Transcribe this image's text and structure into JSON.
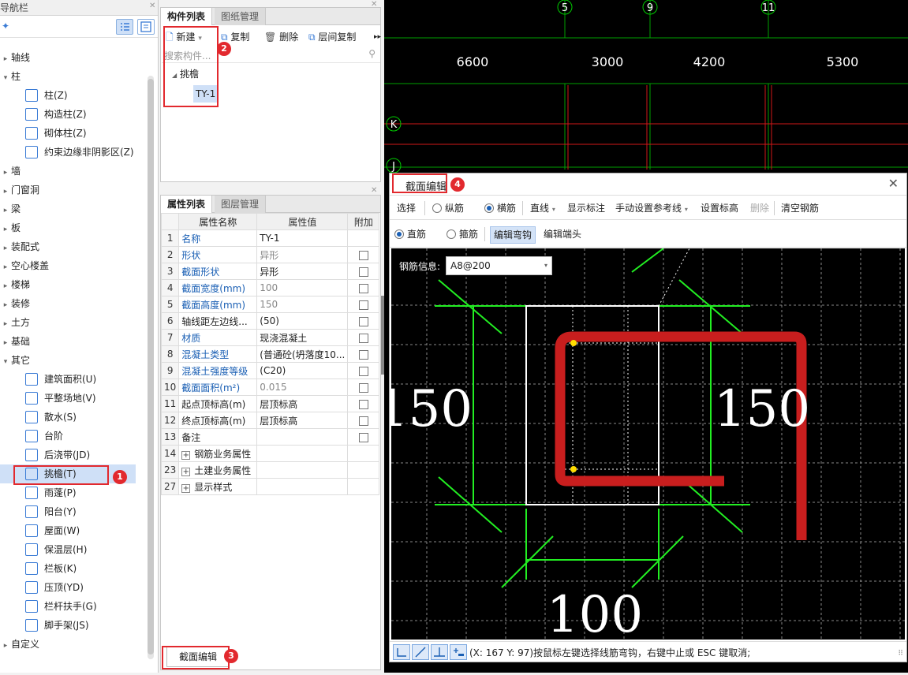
{
  "nav": {
    "title": "导航栏",
    "groups": [
      {
        "label": "轴线",
        "expanded": false
      },
      {
        "label": "柱",
        "expanded": true
      },
      {
        "label": "墙",
        "expanded": false
      },
      {
        "label": "门窗洞",
        "expanded": false
      },
      {
        "label": "梁",
        "expanded": false
      },
      {
        "label": "板",
        "expanded": false
      },
      {
        "label": "装配式",
        "expanded": false
      },
      {
        "label": "空心楼盖",
        "expanded": false
      },
      {
        "label": "楼梯",
        "expanded": false
      },
      {
        "label": "装修",
        "expanded": false
      },
      {
        "label": "土方",
        "expanded": false
      },
      {
        "label": "基础",
        "expanded": false
      },
      {
        "label": "其它",
        "expanded": true
      },
      {
        "label": "自定义",
        "expanded": false
      }
    ],
    "col_items": [
      "柱(Z)",
      "构造柱(Z)",
      "砌体柱(Z)",
      "约束边缘非阴影区(Z)"
    ],
    "other_items": [
      "建筑面积(U)",
      "平整场地(V)",
      "散水(S)",
      "台阶",
      "后浇带(JD)",
      "挑檐(T)",
      "雨蓬(P)",
      "阳台(Y)",
      "屋面(W)",
      "保温层(H)",
      "栏板(K)",
      "压顶(YD)",
      "栏杆扶手(G)",
      "脚手架(JS)"
    ],
    "selected": "挑檐(T)"
  },
  "component_panel": {
    "tabs": [
      "构件列表",
      "图纸管理"
    ],
    "new_label": "新建",
    "copy_label": "复制",
    "delete_label": "删除",
    "floor_copy_label": "层间复制",
    "search_placeholder": "搜索构件...",
    "tree_group": "挑檐",
    "tree_item": "TY-1"
  },
  "attr_panel": {
    "tabs": [
      "属性列表",
      "图层管理"
    ],
    "headers": [
      "属性名称",
      "属性值",
      "附加"
    ],
    "rows": [
      {
        "n": "1",
        "k": "名称",
        "v": "TY-1",
        "cb": false,
        "blue": true
      },
      {
        "n": "2",
        "k": "形状",
        "v": "异形",
        "cb": true,
        "blue": true,
        "gray": true
      },
      {
        "n": "3",
        "k": "截面形状",
        "v": "异形",
        "cb": true,
        "blue": true
      },
      {
        "n": "4",
        "k": "截面宽度(mm)",
        "v": "100",
        "cb": true,
        "blue": true,
        "gray": true
      },
      {
        "n": "5",
        "k": "截面高度(mm)",
        "v": "150",
        "cb": true,
        "blue": true,
        "gray": true
      },
      {
        "n": "6",
        "k": "轴线距左边线...",
        "v": "(50)",
        "cb": true,
        "blue": false
      },
      {
        "n": "7",
        "k": "材质",
        "v": "现浇混凝土",
        "cb": true,
        "blue": true
      },
      {
        "n": "8",
        "k": "混凝土类型",
        "v": "(普通砼(坍落度10...",
        "cb": true,
        "blue": true
      },
      {
        "n": "9",
        "k": "混凝土强度等级",
        "v": "(C20)",
        "cb": true,
        "blue": true
      },
      {
        "n": "10",
        "k": "截面面积(m²)",
        "v": "0.015",
        "cb": true,
        "blue": true,
        "gray": true
      },
      {
        "n": "11",
        "k": "起点顶标高(m)",
        "v": "层顶标高",
        "cb": true,
        "blue": false
      },
      {
        "n": "12",
        "k": "终点顶标高(m)",
        "v": "层顶标高",
        "cb": true,
        "blue": false
      },
      {
        "n": "13",
        "k": "备注",
        "v": "",
        "cb": true,
        "blue": false
      },
      {
        "n": "14",
        "k": "钢筋业务属性",
        "v": "",
        "cb": false,
        "blue": false,
        "expand": true
      },
      {
        "n": "23",
        "k": "土建业务属性",
        "v": "",
        "cb": false,
        "blue": false,
        "expand": true
      },
      {
        "n": "27",
        "k": "显示样式",
        "v": "",
        "cb": false,
        "blue": false,
        "expand": true
      }
    ]
  },
  "section_edit_button": "截面编辑",
  "axes": {
    "numbers": [
      "5",
      "9",
      "11"
    ],
    "letters": [
      "K",
      "J"
    ],
    "spans": [
      "6600",
      "3000",
      "4200",
      "5300"
    ]
  },
  "dialog": {
    "title": "截面编辑",
    "toolbar": [
      "选择",
      "纵筋",
      "横筋",
      "直线",
      "显示标注",
      "手动设置参考线",
      "设置标高",
      "删除",
      "清空钢筋"
    ],
    "row2": [
      "直筋",
      "箍筋",
      "编辑弯钩",
      "编辑端头"
    ],
    "rebar_info_label": "钢筋信息:",
    "rebar_info_value": "A8@200",
    "dim_left": "150",
    "dim_right": "150",
    "dim_bottom": "100",
    "status": "(X: 167 Y: 97)按鼠标左键选择线筋弯钩，右键中止或 ESC 键取消;"
  },
  "badges": [
    "1",
    "2",
    "3",
    "4"
  ],
  "colors": {
    "accent": "#1a5fb4",
    "highlight": "#e2292e",
    "grid": "#00cc00",
    "rebar": "#c81e1e"
  }
}
